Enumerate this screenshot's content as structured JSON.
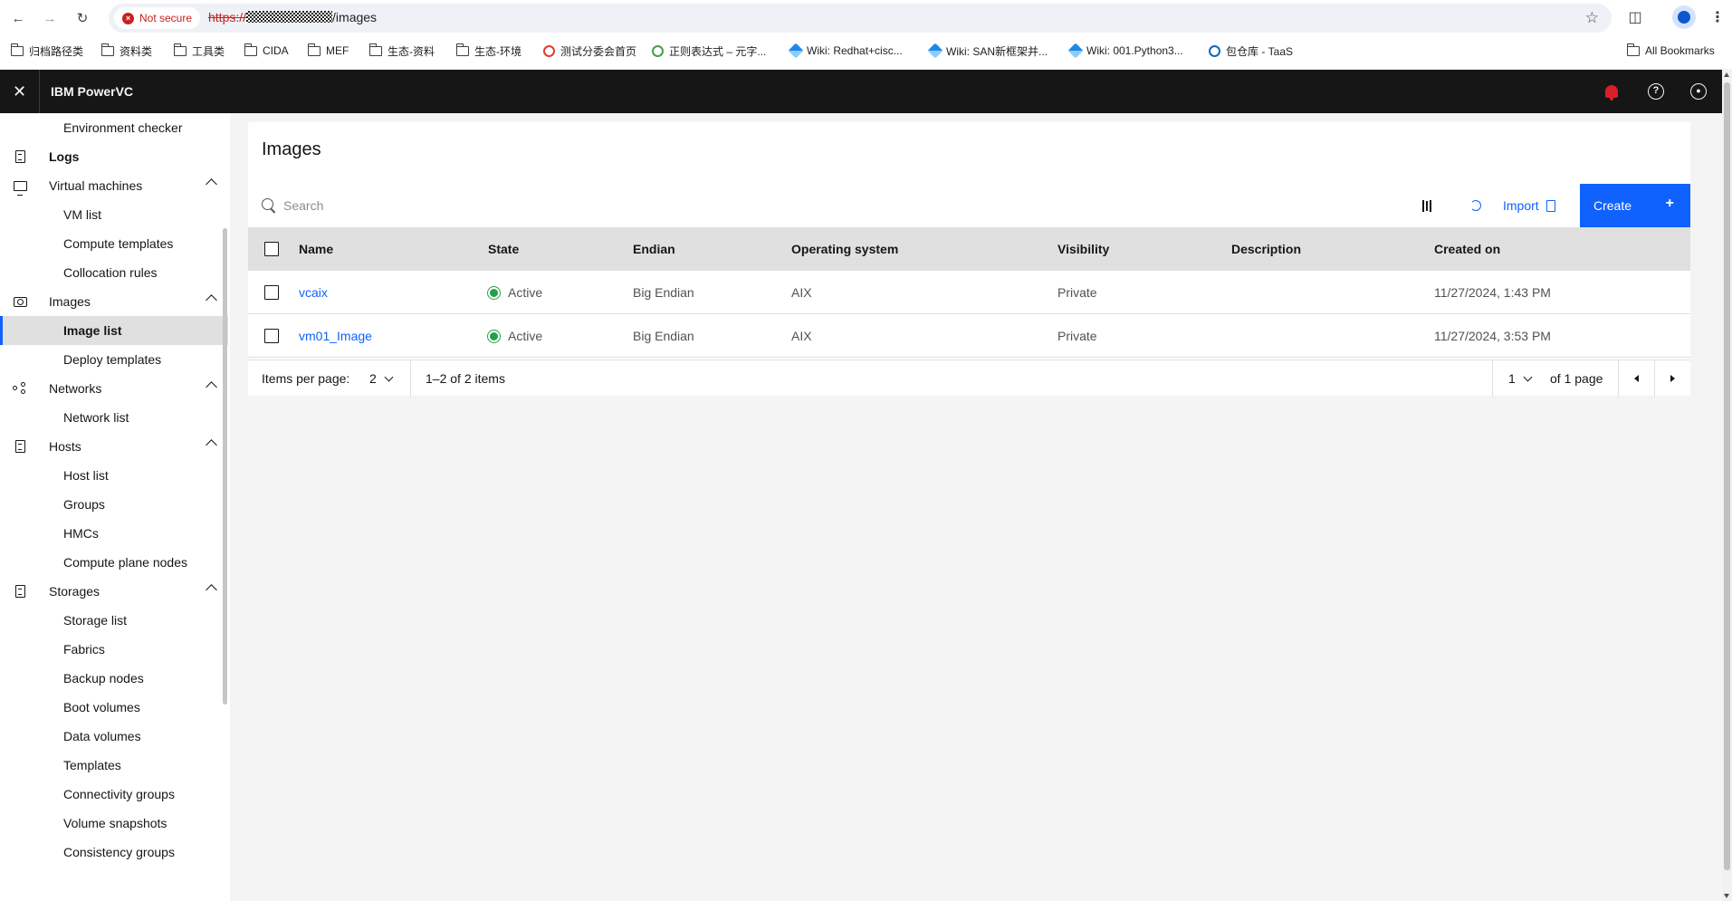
{
  "browser": {
    "security_label": "Not secure",
    "url_scheme": "https://",
    "url_path": "/images",
    "bookmarks": [
      {
        "label": "归档路径类",
        "icon": "folder-icon"
      },
      {
        "label": "资料类",
        "icon": "folder-icon"
      },
      {
        "label": "工具类",
        "icon": "folder-icon"
      },
      {
        "label": "CIDA",
        "icon": "folder-icon"
      },
      {
        "label": "MEF",
        "icon": "folder-icon"
      },
      {
        "label": "生态-资料",
        "icon": "folder-icon"
      },
      {
        "label": "生态-环境",
        "icon": "folder-icon"
      },
      {
        "label": "测试分委会首页",
        "icon": "site-icon"
      },
      {
        "label": "正则表达式 – 元字...",
        "icon": "site-icon"
      },
      {
        "label": "Wiki: Redhat+cisc...",
        "icon": "wiki-icon"
      },
      {
        "label": "Wiki: SAN新框架并...",
        "icon": "wiki-icon"
      },
      {
        "label": "Wiki: 001.Python3...",
        "icon": "wiki-icon"
      },
      {
        "label": "包仓库 - TaaS",
        "icon": "site-icon"
      }
    ],
    "all_bookmarks_label": "All Bookmarks"
  },
  "header": {
    "app_name": "IBM PowerVC"
  },
  "sidenav": {
    "items": [
      {
        "label": "Environment checker",
        "kind": "sub"
      },
      {
        "label": "Logs",
        "kind": "top",
        "icon": "logs-icon"
      },
      {
        "label": "Virtual machines",
        "kind": "cat",
        "icon": "monitor-icon"
      },
      {
        "label": "VM list",
        "kind": "sub"
      },
      {
        "label": "Compute templates",
        "kind": "sub"
      },
      {
        "label": "Collocation rules",
        "kind": "sub"
      },
      {
        "label": "Images",
        "kind": "cat",
        "icon": "camera-icon"
      },
      {
        "label": "Image list",
        "kind": "sub",
        "selected": true
      },
      {
        "label": "Deploy templates",
        "kind": "sub"
      },
      {
        "label": "Networks",
        "kind": "cat",
        "icon": "network-icon"
      },
      {
        "label": "Network list",
        "kind": "sub"
      },
      {
        "label": "Hosts",
        "kind": "cat",
        "icon": "hosts-icon"
      },
      {
        "label": "Host list",
        "kind": "sub"
      },
      {
        "label": "Groups",
        "kind": "sub"
      },
      {
        "label": "HMCs",
        "kind": "sub"
      },
      {
        "label": "Compute plane nodes",
        "kind": "sub"
      },
      {
        "label": "Storages",
        "kind": "cat",
        "icon": "storage-icon"
      },
      {
        "label": "Storage list",
        "kind": "sub"
      },
      {
        "label": "Fabrics",
        "kind": "sub"
      },
      {
        "label": "Backup nodes",
        "kind": "sub"
      },
      {
        "label": "Boot volumes",
        "kind": "sub"
      },
      {
        "label": "Data volumes",
        "kind": "sub"
      },
      {
        "label": "Templates",
        "kind": "sub"
      },
      {
        "label": "Connectivity groups",
        "kind": "sub"
      },
      {
        "label": "Volume snapshots",
        "kind": "sub"
      },
      {
        "label": "Consistency groups",
        "kind": "sub"
      }
    ]
  },
  "main": {
    "title": "Images",
    "search_placeholder": "Search",
    "import_label": "Import",
    "create_label": "Create",
    "columns": [
      "Name",
      "State",
      "Endian",
      "Operating system",
      "Visibility",
      "Description",
      "Created on"
    ],
    "rows": [
      {
        "name": "vcaix",
        "state": "Active",
        "endian": "Big Endian",
        "os": "AIX",
        "visibility": "Private",
        "description": "",
        "created_on": "11/27/2024, 1:43 PM"
      },
      {
        "name": "vm01_Image",
        "state": "Active",
        "endian": "Big Endian",
        "os": "AIX",
        "visibility": "Private",
        "description": "",
        "created_on": "11/27/2024, 3:53 PM"
      }
    ],
    "pagination": {
      "items_per_page_label": "Items per page:",
      "items_per_page_value": "2",
      "range_text": "1–2 of 2 items",
      "page_value": "1",
      "of_pages_text": "of 1 page"
    }
  },
  "colors": {
    "accent": "#0f62fe",
    "header_bg": "#161616",
    "active_status": "#24a148",
    "notification": "#da1e28"
  }
}
